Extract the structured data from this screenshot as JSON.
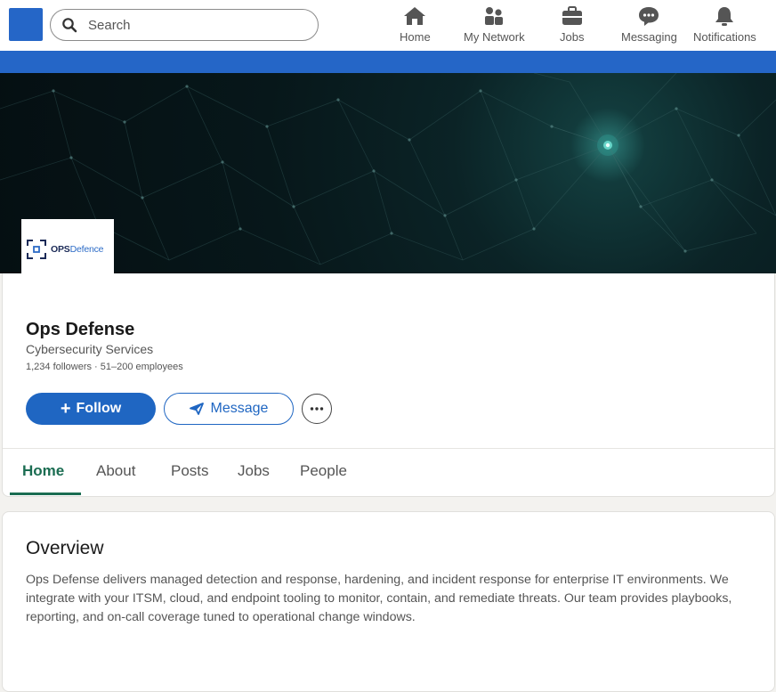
{
  "search": {
    "placeholder": "Search"
  },
  "nav": {
    "home": "Home",
    "network": "My Network",
    "jobs": "Jobs",
    "messaging": "Messaging",
    "notifications": "Notifications"
  },
  "banner": {
    "logo_primary": "OPS",
    "logo_accent": "Defence"
  },
  "company": {
    "name": "Ops Defense",
    "industry": "Cybersecurity Services",
    "stats": "1,234 followers · 51–200 employees"
  },
  "actions": {
    "follow": "Follow",
    "message": "Message"
  },
  "tabs": [
    "Home",
    "About",
    "Posts",
    "Jobs",
    "People"
  ],
  "overview": {
    "title": "Overview",
    "body": "Ops Defense delivers managed detection and response, hardening, and incident response for enterprise IT environments. We integrate with your ITSM, cloud, and endpoint tooling to monitor, contain, and remediate threats. Our team provides playbooks, reporting, and on-call coverage tuned to operational change windows."
  },
  "colors": {
    "brand_blue": "#2566c7",
    "button_blue": "#1f66c2",
    "active_tab": "#1b6d52"
  }
}
